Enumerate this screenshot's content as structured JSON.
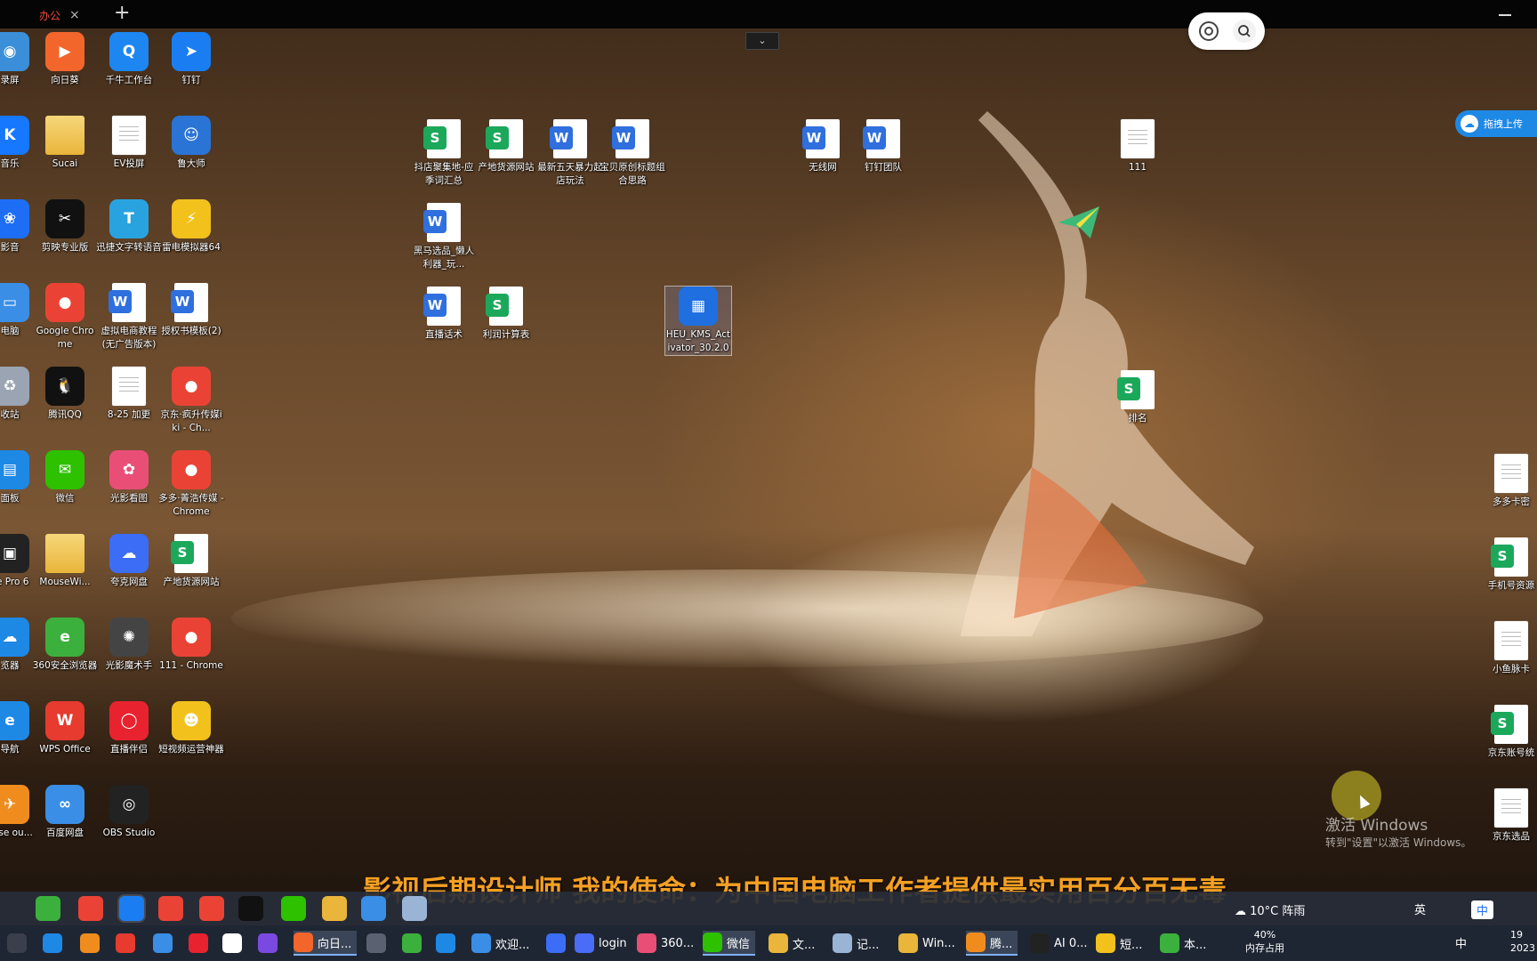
{
  "browser": {
    "tab_label": "办公",
    "close": "×",
    "new_tab": "+"
  },
  "desktop": {
    "icons": [
      {
        "label": "录屏",
        "kind": "app",
        "color": "#3b8fd9",
        "glyph": "◉"
      },
      {
        "label": "向日葵",
        "kind": "app",
        "color": "#f2662b",
        "glyph": "▶"
      },
      {
        "label": "千牛工作台",
        "kind": "app",
        "color": "#1d86f0",
        "glyph": "Q"
      },
      {
        "label": "钉钉",
        "kind": "app",
        "color": "#1a7ef2",
        "glyph": "➤"
      },
      {
        "label": "音乐",
        "kind": "app",
        "color": "#1677ff",
        "glyph": "K"
      },
      {
        "label": "Sucai",
        "kind": "folder",
        "color": "#e9b53a",
        "glyph": ""
      },
      {
        "label": "EV投屏",
        "kind": "doc",
        "color": "#ffffff",
        "glyph": ""
      },
      {
        "label": "鲁大师",
        "kind": "app",
        "color": "#2a74d6",
        "glyph": "☺"
      },
      {
        "label": "影音",
        "kind": "app",
        "color": "#1e6ef5",
        "glyph": "❀"
      },
      {
        "label": "剪映专业版",
        "kind": "app",
        "color": "#111111",
        "glyph": "✂"
      },
      {
        "label": "迅捷文字转语音",
        "kind": "app",
        "color": "#29a3e0",
        "glyph": "T"
      },
      {
        "label": "雷电模拟器64",
        "kind": "app",
        "color": "#f2c11c",
        "glyph": "⚡"
      },
      {
        "label": "电脑",
        "kind": "app",
        "color": "#3a8ee6",
        "glyph": "▭"
      },
      {
        "label": "Google Chrome",
        "kind": "app",
        "color": "#ea4335",
        "glyph": "●"
      },
      {
        "label": "虚拟电商教程(无广告版本)",
        "kind": "word",
        "color": "#2f6fde",
        "glyph": "W"
      },
      {
        "label": "授权书模板(2)",
        "kind": "word",
        "color": "#2f6fde",
        "glyph": "W"
      },
      {
        "label": "收站",
        "kind": "app",
        "color": "#9aa4b2",
        "glyph": "♻"
      },
      {
        "label": "腾讯QQ",
        "kind": "app",
        "color": "#111111",
        "glyph": "🐧"
      },
      {
        "label": "8-25 加更",
        "kind": "doc",
        "color": "#ffffff",
        "glyph": ""
      },
      {
        "label": "京东·疯升传媒iki - Ch...",
        "kind": "app",
        "color": "#ea4335",
        "glyph": "●"
      },
      {
        "label": "面板",
        "kind": "app",
        "color": "#1e88e5",
        "glyph": "▤"
      },
      {
        "label": "微信",
        "kind": "app",
        "color": "#2dc100",
        "glyph": "✉"
      },
      {
        "label": "光影看图",
        "kind": "app",
        "color": "#e94e77",
        "glyph": "✿"
      },
      {
        "label": "多多·菁浩传媒 - Chrome",
        "kind": "app",
        "color": "#ea4335",
        "glyph": "●"
      },
      {
        "label": "ee Pro 6",
        "kind": "app",
        "color": "#222222",
        "glyph": "▣"
      },
      {
        "label": "MouseWi...",
        "kind": "folder",
        "color": "#e9b53a",
        "glyph": ""
      },
      {
        "label": "夸克网盘",
        "kind": "app",
        "color": "#3b6df6",
        "glyph": "☁"
      },
      {
        "label": "产地货源网站",
        "kind": "sheet",
        "color": "#1ca85b",
        "glyph": "S"
      },
      {
        "label": "览器",
        "kind": "app",
        "color": "#1e88e5",
        "glyph": "☁"
      },
      {
        "label": "360安全浏览器",
        "kind": "app",
        "color": "#3cb03c",
        "glyph": "e"
      },
      {
        "label": "光影魔术手",
        "kind": "app",
        "color": "#444444",
        "glyph": "✺"
      },
      {
        "label": "111 - Chrome",
        "kind": "app",
        "color": "#ea4335",
        "glyph": "●"
      },
      {
        "label": "导航",
        "kind": "app",
        "color": "#1e88e5",
        "glyph": "e"
      },
      {
        "label": "WPS Office",
        "kind": "app",
        "color": "#e63b2e",
        "glyph": "W"
      },
      {
        "label": "直播伴侣",
        "kind": "app",
        "color": "#e8222f",
        "glyph": "◯"
      },
      {
        "label": "短视频运营神器",
        "kind": "app",
        "color": "#f2c11c",
        "glyph": "☻"
      },
      {
        "label": "ouse ou...",
        "kind": "app",
        "color": "#f08c1e",
        "glyph": "✈"
      },
      {
        "label": "百度网盘",
        "kind": "app",
        "color": "#3a8ee6",
        "glyph": "∞"
      },
      {
        "label": "OBS Studio",
        "kind": "app",
        "color": "#222222",
        "glyph": "◎"
      },
      {
        "label": "抖店聚集地-应季词汇总",
        "kind": "sheet",
        "color": "#1ca85b",
        "glyph": "S"
      },
      {
        "label": "产地货源网站",
        "kind": "sheet",
        "color": "#1ca85b",
        "glyph": "S"
      },
      {
        "label": "最新五天暴力起店玩法",
        "kind": "word",
        "color": "#2f6fde",
        "glyph": "W"
      },
      {
        "label": "宝贝原创标题组合思路",
        "kind": "word",
        "color": "#2f6fde",
        "glyph": "W"
      },
      {
        "label": "黑马选品_懒人利器_玩...",
        "kind": "word",
        "color": "#2f6fde",
        "glyph": "W"
      },
      {
        "label": "直播话术",
        "kind": "word",
        "color": "#2f6fde",
        "glyph": "W"
      },
      {
        "label": "利润计算表",
        "kind": "sheet",
        "color": "#1ca85b",
        "glyph": "S"
      },
      {
        "label": "HEU_KMS_Activator_30.2.0",
        "kind": "app",
        "color": "#1f6fe0",
        "glyph": "▦"
      },
      {
        "label": "无线网",
        "kind": "word",
        "color": "#2f6fde",
        "glyph": "W"
      },
      {
        "label": "钉钉团队",
        "kind": "word",
        "color": "#2f6fde",
        "glyph": "W"
      },
      {
        "label": "111",
        "kind": "doc",
        "color": "#ffffff",
        "glyph": ""
      },
      {
        "label": "排名",
        "kind": "sheet",
        "color": "#1ca85b",
        "glyph": "S"
      },
      {
        "label": "多多卡密",
        "kind": "doc",
        "color": "#ffffff",
        "glyph": ""
      },
      {
        "label": "手机号资源",
        "kind": "sheet",
        "color": "#1ca85b",
        "glyph": "S"
      },
      {
        "label": "小鱼脉卡",
        "kind": "doc",
        "color": "#ffffff",
        "glyph": ""
      },
      {
        "label": "京东账号统",
        "kind": "sheet",
        "color": "#1ca85b",
        "glyph": "S"
      },
      {
        "label": "京东选品",
        "kind": "doc",
        "color": "#ffffff",
        "glyph": ""
      }
    ]
  },
  "overlay": {
    "side_button": "拖拽上传",
    "watermark_title": "激活 Windows",
    "watermark_sub": "转到\"设置\"以激活 Windows。",
    "subtitle": "影视后期设计师  我的使命：为中国电脑工作者提供最实用百分百无毒"
  },
  "taskbar": {
    "pinned_colors": [
      "#3cb03c",
      "#ea4335",
      "#1a7ef2",
      "#ea4335",
      "#ea4335",
      "#111111",
      "#2dc100",
      "#e9b53a",
      "#3a8ee6",
      "#9ab4d6"
    ],
    "weather": "10°C 阵雨",
    "ime_lang": "英",
    "ime_chinese": "中",
    "apps": [
      {
        "label": "",
        "color": "#3a3f4b"
      },
      {
        "label": "",
        "color": "#1e88e5"
      },
      {
        "label": "",
        "color": "#f08c1e"
      },
      {
        "label": "",
        "color": "#e63b2e"
      },
      {
        "label": "",
        "color": "#3a8ee6"
      },
      {
        "label": "",
        "color": "#e8222f"
      },
      {
        "label": "",
        "color": "#ffffff"
      },
      {
        "label": "",
        "color": "#7a4ae0"
      },
      {
        "label": "向日...",
        "color": "#f2662b"
      },
      {
        "label": "",
        "color": "#5a6272"
      },
      {
        "label": "",
        "color": "#3cb03c"
      },
      {
        "label": "",
        "color": "#1e88e5"
      },
      {
        "label": "欢迎...",
        "color": "#3a8ee6"
      },
      {
        "label": "",
        "color": "#3b6df6"
      },
      {
        "label": "login",
        "color": "#4a6cf7"
      },
      {
        "label": "360...",
        "color": "#e94e77"
      },
      {
        "label": "微信",
        "color": "#2dc100"
      },
      {
        "label": "文...",
        "color": "#e9b53a"
      },
      {
        "label": "记...",
        "color": "#9ab4d6"
      },
      {
        "label": "Win...",
        "color": "#e9b53a"
      },
      {
        "label": "腾...",
        "color": "#f08c1e"
      },
      {
        "label": "AI 0...",
        "color": "#222222"
      },
      {
        "label": "短...",
        "color": "#f2c11c"
      },
      {
        "label": "本...",
        "color": "#3cb03c"
      }
    ],
    "memory_percent": "40%",
    "memory_label": "内存占用",
    "tray_lang": "中",
    "clock_time": "19",
    "clock_date": "2023"
  }
}
